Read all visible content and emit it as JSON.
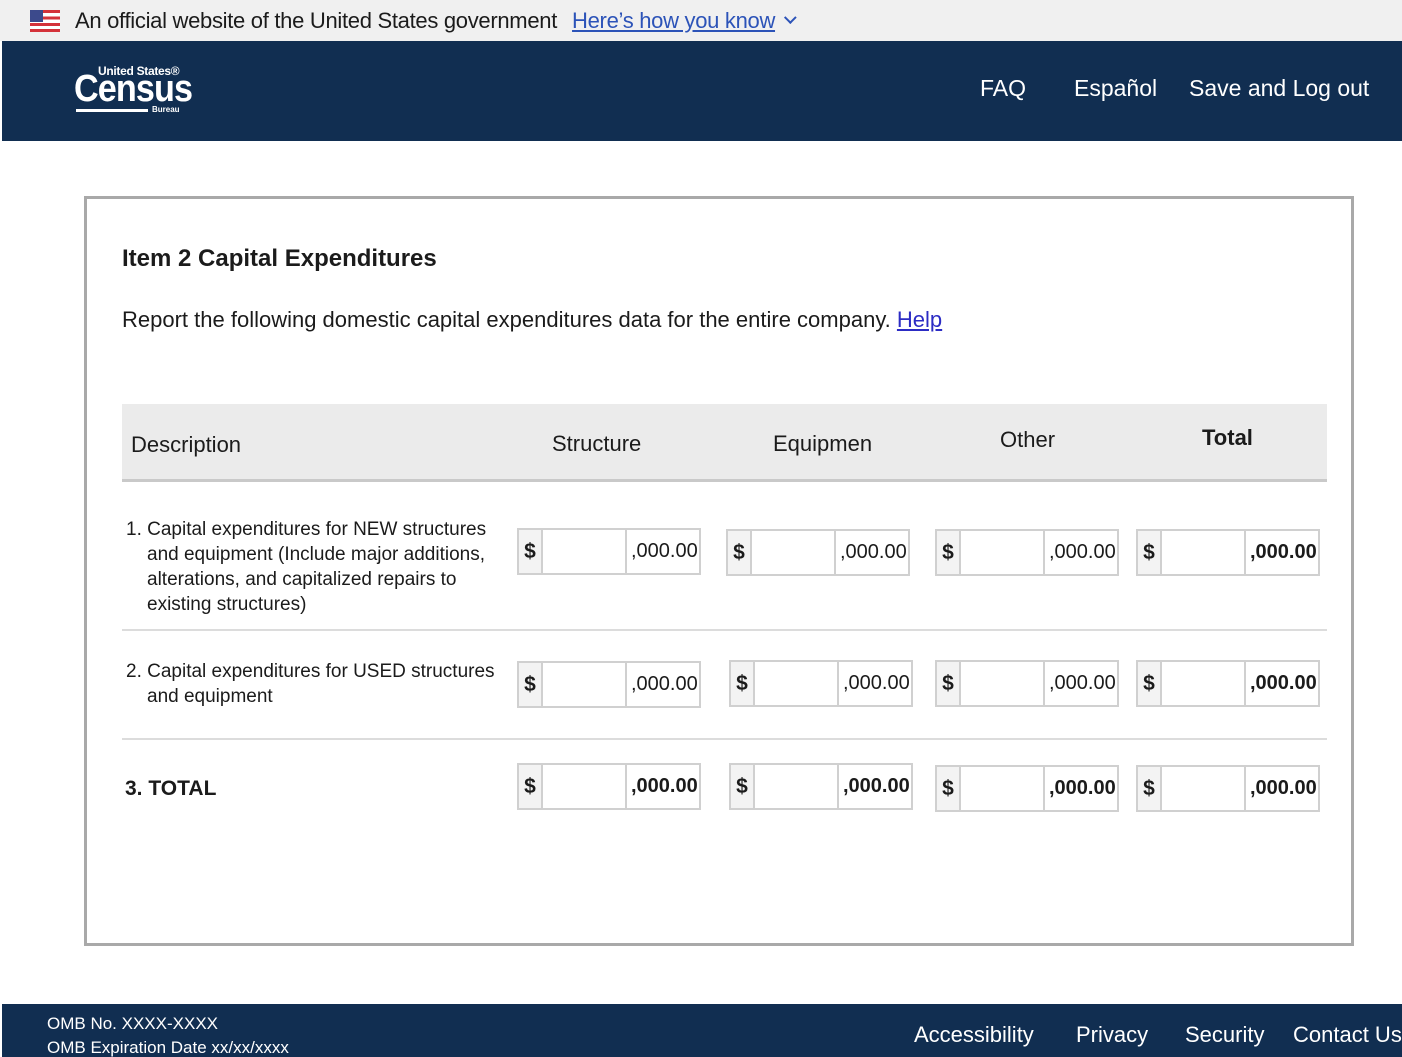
{
  "gov_banner": {
    "text": "An official website of the United States government",
    "link": "Here’s how you know"
  },
  "header": {
    "logo": {
      "small": "United States®",
      "big": "Census",
      "bureau": "Bureau"
    },
    "nav": {
      "faq": "FAQ",
      "espanol": "Español",
      "save": "Save and Log out"
    }
  },
  "form": {
    "title": "Item 2 Capital Expenditures",
    "intro": "Report the following domestic capital expenditures data for the entire company.",
    "help": "Help",
    "columns": [
      "Description",
      "Structure",
      "Equipmen",
      "Other",
      "Total"
    ],
    "rows": [
      {
        "label_first": "1. Capital expenditures for NEW structures",
        "label_rest": [
          "and equipment (Include major additions,",
          "alterations, and capitalized repairs to",
          "existing structures)"
        ]
      },
      {
        "label_first": "2. Capital expenditures for USED structures",
        "label_rest": [
          "and equipment"
        ]
      },
      {
        "label_first": "3. TOTAL",
        "label_rest": []
      }
    ],
    "currency_symbol": "$",
    "amount_suffix": ",000.00"
  },
  "footer": {
    "omb_no": "OMB No. XXXX-XXXX",
    "omb_exp": "OMB Expiration Date xx/xx/xxxx",
    "links": [
      "Accessibility",
      "Privacy",
      "Security",
      "Contact Us"
    ]
  }
}
